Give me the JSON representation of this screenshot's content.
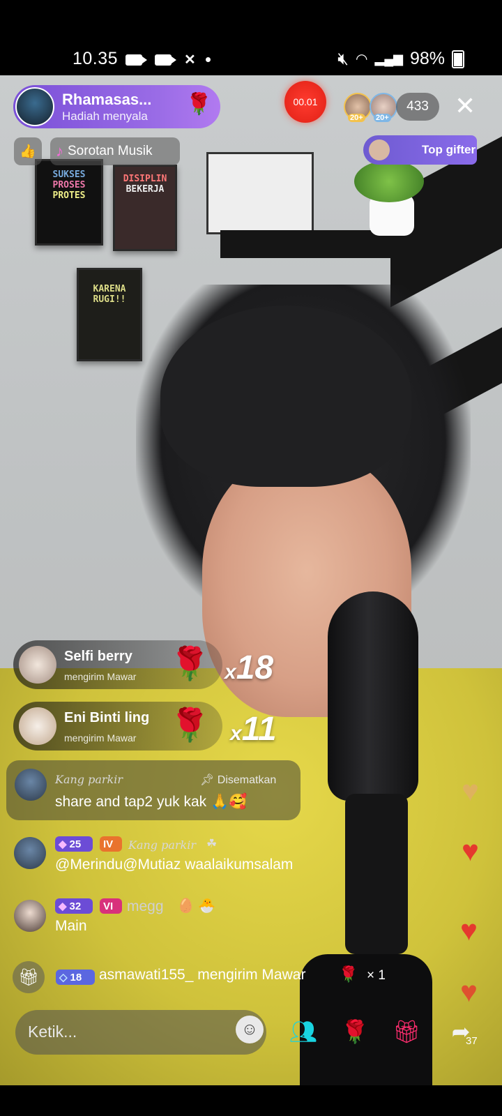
{
  "status_bar": {
    "time": "10.35",
    "battery": "98%"
  },
  "host": {
    "name": "Rhamasas...",
    "subtitle": "Hadiah menyala"
  },
  "live_timer": "00.01",
  "viewers": {
    "badges": [
      "20+",
      "20+"
    ],
    "count": "433"
  },
  "chips": {
    "music_label": "Sorotan Musik",
    "top_gifter_label": "Top gifter"
  },
  "gift_banners": [
    {
      "name": "Selfi berry",
      "action": "mengirim Mawar",
      "multiplier": "x",
      "count": "18"
    },
    {
      "name": "Eni Binti ling",
      "action": "mengirim Mawar",
      "multiplier": "x",
      "count": "11"
    }
  ],
  "pinned_comment": {
    "user": "Kang parkir",
    "pinned_label": "Disematkan",
    "text": "share and tap2 yuk kak 🙏🥰"
  },
  "comments": [
    {
      "level": "25",
      "tier": "IV",
      "user": "Kang parkir",
      "text": "@Merindu@Mutiaz waalaikumsalam"
    },
    {
      "level": "32",
      "tier": "VI",
      "user": "megg",
      "text": "Main"
    }
  ],
  "ticker": {
    "level": "18",
    "text": "asmawati155_ mengirim Mawar",
    "count": "× 1"
  },
  "input": {
    "placeholder": "Ketik..."
  },
  "share_count": "37",
  "icons": {
    "close": "close-icon",
    "gift": "gift-icon",
    "rose": "rose-icon",
    "emoji": "emoji-icon",
    "share": "share-icon",
    "co-host": "co-host-icon"
  },
  "colors": {
    "host_pill": "#8a5fe2",
    "live_red": "#ff3b2f",
    "heart": "#e5392e",
    "gift_pink": "#ff2d6f"
  }
}
